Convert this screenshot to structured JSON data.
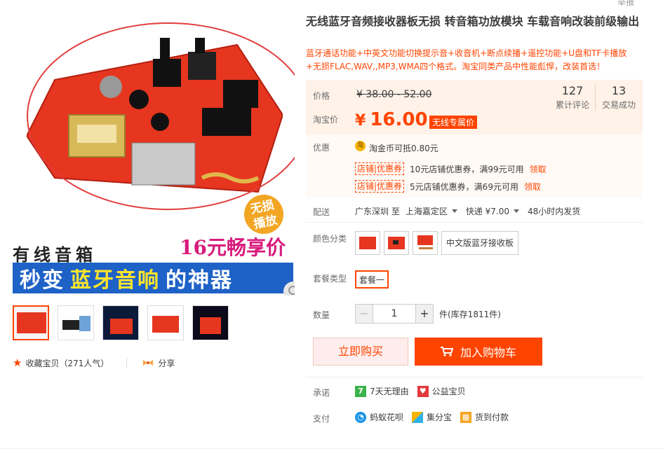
{
  "gallery": {
    "promo_line1": "有线音箱",
    "promo_price": "16元畅享价",
    "promo_bar_a": "秒变",
    "promo_bar_b": "蓝牙音响",
    "promo_bar_c": "的神器",
    "badge": "无损\n播放",
    "thumbnails": [
      "thumb-1",
      "thumb-2",
      "thumb-3",
      "thumb-4",
      "thumb-5"
    ]
  },
  "actions": {
    "favorite": "收藏宝贝（271人气）",
    "share": "分享"
  },
  "header": {
    "top_cut_text": "举报"
  },
  "product": {
    "title": "无线蓝牙音频接收器板无损 转音箱功放模块 车载音响改装前级输出",
    "subtitle": "蓝牙通话功能+中英文功能切换提示音+收音机+断点续播+遥控功能+U盘和TF卡播放+无损FLAC,WAV,,MP3,WMA四个格式。淘宝同类产品中性能彪悍，改装首选！"
  },
  "price": {
    "label_price": "价格",
    "old_price": "¥ 38.00 - 52.00",
    "label_taobao": "淘宝价",
    "currency": "¥",
    "new_price": "16.00",
    "promo_tag": "无线专属价",
    "reviews_count": "127",
    "reviews_label": "累计评论",
    "deals_count": "13",
    "deals_label": "交易成功"
  },
  "promotions": {
    "label": "优惠",
    "coin_text": "淘金币可抵0.80元",
    "coin_icon": "淘",
    "coupons": [
      {
        "tag": "店铺|优惠券",
        "text": "10元店铺优惠券，满99元可用",
        "link": "领取"
      },
      {
        "tag": "店铺|优惠券",
        "text": "5元店铺优惠券，满69元可用",
        "link": "领取"
      }
    ]
  },
  "shipping": {
    "label": "配送",
    "from": "广东深圳 至",
    "to": "上海嘉定区",
    "method": "快递 ¥7.00",
    "dispatch": "48小时内发货"
  },
  "options": {
    "color_label": "颜色分类",
    "color_text_option": "中文版蓝牙接收板",
    "package_label": "套餐类型",
    "package_value": "套餐一"
  },
  "quantity": {
    "label": "数量",
    "minus": "−",
    "value": "1",
    "plus": "+",
    "stock": "件(库存1811件)"
  },
  "buttons": {
    "buy_now": "立即购买",
    "add_cart": "加入购物车"
  },
  "guarantee": {
    "label": "承诺",
    "items": [
      "7天无理由",
      "公益宝贝"
    ],
    "icon_7": "7"
  },
  "payment": {
    "label": "支付",
    "items": [
      "蚂蚁花呗",
      "集分宝",
      "货到付款"
    ]
  },
  "colors": {
    "accent": "#ff4400",
    "price_bg": "#fff2e8"
  }
}
